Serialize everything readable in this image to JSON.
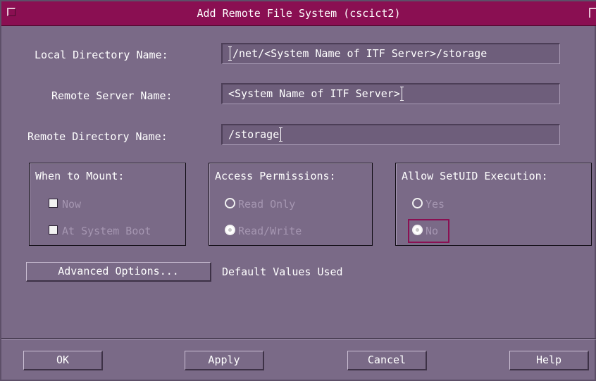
{
  "window": {
    "title": "Add Remote File System (cscict2)"
  },
  "fields": {
    "local_dir": {
      "label": "Local Directory Name:",
      "value": "/net/<System Name of ITF Server>/storage"
    },
    "remote_server": {
      "label": "Remote Server Name:",
      "value": "<System Name of ITF Server>"
    },
    "remote_dir": {
      "label": "Remote Directory Name:",
      "value": "/storage"
    }
  },
  "groups": {
    "mount": {
      "title": "When to Mount:",
      "options": [
        {
          "label": "Now",
          "checked": true
        },
        {
          "label": "At System Boot",
          "checked": true
        }
      ]
    },
    "access": {
      "title": "Access Permissions:",
      "options": [
        {
          "label": "Read Only",
          "selected": false
        },
        {
          "label": "Read/Write",
          "selected": true
        }
      ]
    },
    "setuid": {
      "title": "Allow SetUID Execution:",
      "options": [
        {
          "label": "Yes",
          "selected": false
        },
        {
          "label": "No",
          "selected": true
        }
      ]
    }
  },
  "advanced": {
    "button_label": "Advanced Options...",
    "status": "Default Values Used"
  },
  "buttons": {
    "ok": "OK",
    "apply": "Apply",
    "cancel": "Cancel",
    "help": "Help"
  },
  "colors": {
    "background": "#7a6a87",
    "titlebar": "#8a0f52",
    "focus": "#8a0f52",
    "disabled_text": "#a596b1"
  }
}
